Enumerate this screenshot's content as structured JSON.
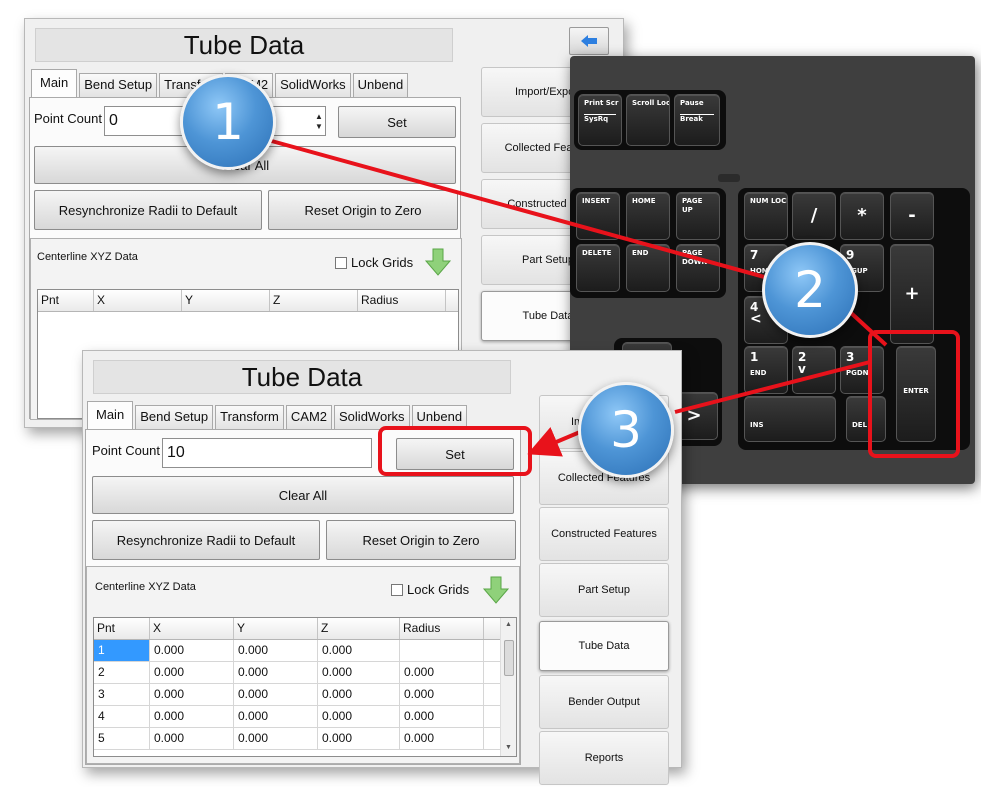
{
  "window_title": "Tube Data",
  "tabs": [
    "Main",
    "Bend Setup",
    "Transform",
    "CAM2",
    "SolidWorks",
    "Unbend"
  ],
  "back_panel": {
    "tabs_visible": [
      "Main",
      "Bend Setup",
      "Transfo",
      "M2",
      "SolidWorks",
      "Unbend"
    ],
    "point_count_value": "0",
    "sidebar": [
      "Import/Export",
      "Collected Feature",
      "Constructed Fea",
      "Part Setup",
      "Tube Data"
    ]
  },
  "main": {
    "point_count_label": "Point Count",
    "point_count_value": "10",
    "set_label": "Set",
    "clear_all_label": "Clear All",
    "resync_label": "Resynchronize Radii to Default",
    "reset_origin_label": "Reset Origin to Zero",
    "group_title": "Centerline XYZ Data",
    "lock_grids_label": "Lock Grids"
  },
  "grid": {
    "headers": [
      "Pnt",
      "X",
      "Y",
      "Z",
      "Radius"
    ],
    "rows": [
      [
        "1",
        "0.000",
        "0.000",
        "0.000",
        ""
      ],
      [
        "2",
        "0.000",
        "0.000",
        "0.000",
        "0.000"
      ],
      [
        "3",
        "0.000",
        "0.000",
        "0.000",
        "0.000"
      ],
      [
        "4",
        "0.000",
        "0.000",
        "0.000",
        "0.000"
      ],
      [
        "5",
        "0.000",
        "0.000",
        "0.000",
        "0.000"
      ]
    ]
  },
  "sidebar": [
    "Import/Export",
    "Collected Features",
    "Constructed Features",
    "Part Setup",
    "Tube Data",
    "Bender Output",
    "Reports"
  ],
  "keyboard": {
    "sys": [
      [
        "Print Scr",
        "SysRq"
      ],
      [
        "Scroll Lock",
        ""
      ],
      [
        "Pause",
        "Break"
      ]
    ],
    "nav": [
      [
        "INSERT",
        ""
      ],
      [
        "HOME",
        ""
      ],
      [
        "PAGE",
        "UP"
      ],
      [
        "DELETE",
        ""
      ],
      [
        "END",
        ""
      ],
      [
        "PAGE",
        "DOWN"
      ]
    ],
    "arrow_up": "^",
    "arrow_right": ">",
    "numpad": {
      "num_lock": "NUM LOCK",
      "slash": "/",
      "star": "*",
      "minus": "-",
      "seven": "7",
      "seven_sub": "HOME",
      "nine": "9",
      "nine_sub": "PGUP",
      "plus": "+",
      "four": "4",
      "four_sub": "<",
      "one": "1",
      "one_sub": "END",
      "two": "2",
      "two_sub": "v",
      "three": "3",
      "three_sub": "PGDN",
      "enter": "ENTER",
      "ins": "INS",
      "del": "DEL"
    }
  },
  "steps": [
    "1",
    "2",
    "3"
  ],
  "colors": {
    "annotation_red": "#e8121b",
    "badge_blue": "#4e95d6",
    "selection_blue": "#3399ff"
  },
  "icons": [
    "back-arrow-icon",
    "green-down-arrow-icon"
  ]
}
